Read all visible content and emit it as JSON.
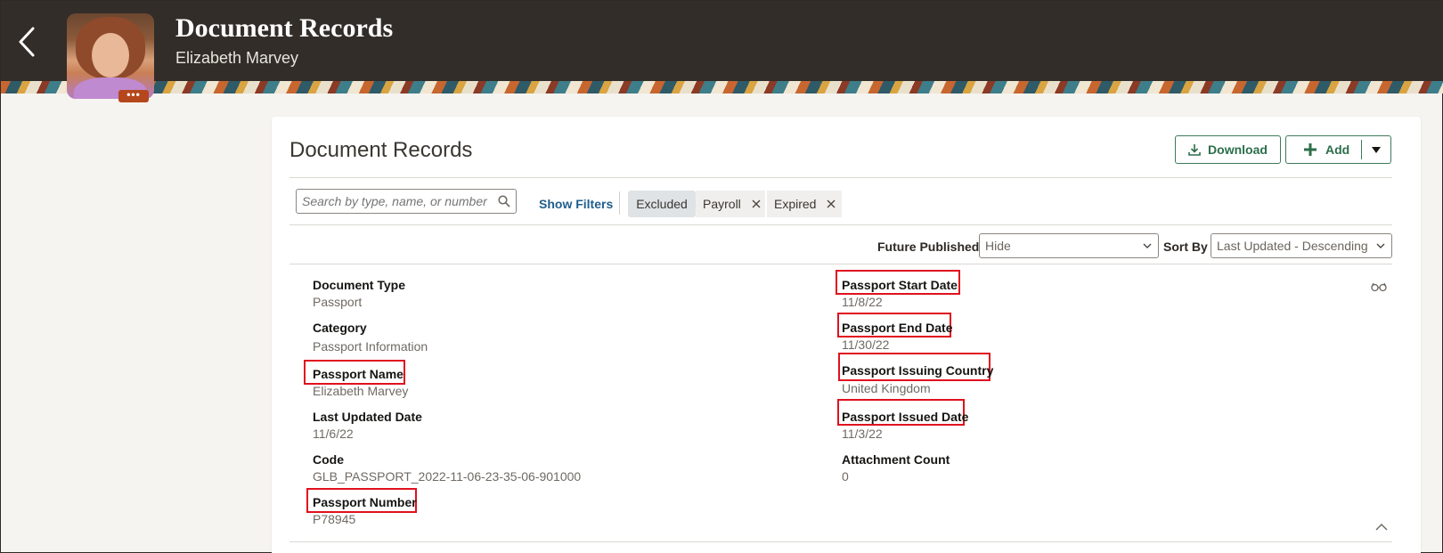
{
  "header": {
    "title": "Document Records",
    "subtitle": "Elizabeth Marvey",
    "avatar_menu": "•••"
  },
  "card": {
    "title": "Document Records",
    "download_label": "Download",
    "add_label": "Add"
  },
  "filters": {
    "search_placeholder": "Search by type, name, or number",
    "show_filters": "Show Filters",
    "chips": [
      "Excluded",
      "Payroll",
      "Expired"
    ]
  },
  "options": {
    "future_published_label": "Future Published",
    "future_published_value": "Hide",
    "sort_by_label": "Sort By",
    "sort_by_value": "Last Updated - Descending"
  },
  "record": {
    "left": [
      {
        "label": "Document Type",
        "value": "Passport"
      },
      {
        "label": "Category",
        "value": "Passport Information"
      },
      {
        "label": "Passport Name",
        "value": "Elizabeth Marvey"
      },
      {
        "label": "Last Updated Date",
        "value": "11/6/22"
      },
      {
        "label": "Code",
        "value": "GLB_PASSPORT_2022-11-06-23-35-06-901000"
      },
      {
        "label": "Passport Number",
        "value": "P78945"
      }
    ],
    "right": [
      {
        "label": "Passport Start Date",
        "value": "11/8/22"
      },
      {
        "label": "Passport End Date",
        "value": "11/30/22"
      },
      {
        "label": "Passport Issuing Country",
        "value": "United Kingdom"
      },
      {
        "label": "Passport Issued Date",
        "value": "11/3/22"
      },
      {
        "label": "Attachment Count",
        "value": "0"
      }
    ]
  },
  "icons": {
    "back": "chevron-left-icon",
    "download": "download-icon",
    "add": "plus-icon",
    "search": "search-icon",
    "close": "close-icon",
    "view": "glasses-icon",
    "collapse": "chevron-up-icon"
  },
  "colors": {
    "header_bg": "#322d29",
    "accent_green": "#2c6e4a",
    "link_blue": "#1f5e8c",
    "highlight_red": "#e0111f"
  }
}
